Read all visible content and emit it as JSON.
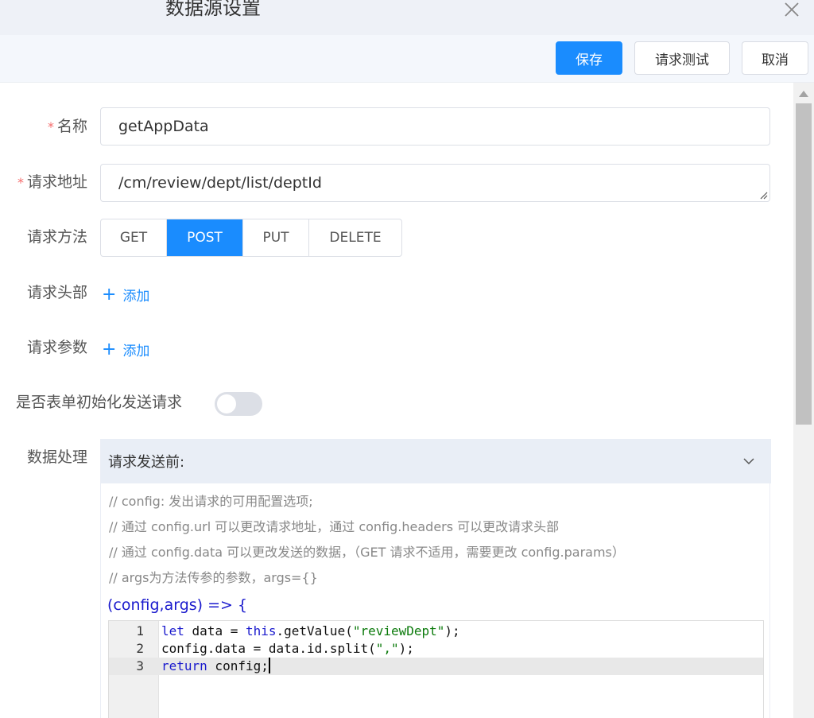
{
  "dialog": {
    "title": "数据源设置"
  },
  "toolbar": {
    "save": "保存",
    "test": "请求测试",
    "cancel": "取消"
  },
  "form": {
    "name_label": "名称",
    "name_value": "getAppData",
    "url_label": "请求地址",
    "url_value": "/cm/review/dept/list/deptId",
    "method_label": "请求方法",
    "methods": [
      "GET",
      "POST",
      "PUT",
      "DELETE"
    ],
    "selected_method": "POST",
    "headers_label": "请求头部",
    "params_label": "请求参数",
    "add_label": "添加",
    "init_label": "是否表单初始化发送请求",
    "init_enabled": false,
    "data_label": "数据处理",
    "required_mark": "*"
  },
  "panel": {
    "title": "请求发送前:",
    "comments": [
      "// config: 发出请求的可用配置选项;",
      "// 通过 config.url 可以更改请求地址，通过 config.headers 可以更改请求头部",
      "// 通过 config.data 可以更改发送的数据，（GET 请求不适用，需要更改 config.params）",
      "// args为方法传参的参数，args={}"
    ],
    "signature": "(config,args) => {",
    "line_numbers": [
      "1",
      "2",
      "3"
    ],
    "code": {
      "l1_kw": "let",
      "l1_a": " data = ",
      "l1_this": "this",
      "l1_b": ".getValue(",
      "l1_str": "\"reviewDept\"",
      "l1_c": ");",
      "l2_a": "config.data = data.id.split(",
      "l2_str": "\",\"",
      "l2_b": ");",
      "l3_kw": "return",
      "l3_a": " config;"
    }
  },
  "colors": {
    "primary": "#1a8cfe",
    "required": "#f56c6c",
    "panel_header": "#e9eef6",
    "keyword": "#1a1acd",
    "string": "#0b7a0b"
  }
}
